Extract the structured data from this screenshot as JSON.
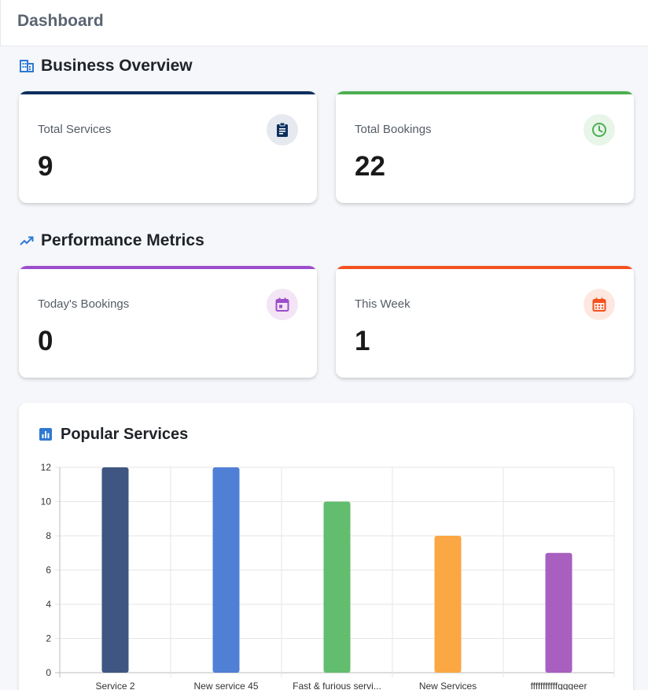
{
  "header": {
    "title": "Dashboard"
  },
  "sections": {
    "business": {
      "title": "Business Overview",
      "icon": "building-icon"
    },
    "performance": {
      "title": "Performance Metrics",
      "icon": "trending-up-icon"
    }
  },
  "cards": [
    {
      "label": "Total Services",
      "value": "9",
      "color": "#0d2f5e",
      "icon": "clipboard-icon"
    },
    {
      "label": "Total Bookings",
      "value": "22",
      "color": "#4caf50",
      "icon": "clock-icon"
    },
    {
      "label": "Today's Bookings",
      "value": "0",
      "color": "#9c4dcc",
      "icon": "calendar-icon"
    },
    {
      "label": "This Week",
      "value": "1",
      "color": "#f4511e",
      "icon": "calendar-week-icon"
    }
  ],
  "popular": {
    "title": "Popular Services",
    "icon": "bar-chart-icon"
  },
  "chart_data": {
    "type": "bar",
    "title": "Popular Services",
    "categories": [
      "Service 2",
      "New service 45",
      "Fast & furious servi...",
      "New Services",
      "fffffffffffgggeer"
    ],
    "values": [
      12,
      12,
      10,
      8,
      7
    ],
    "colors": [
      "#3e5681",
      "#5080d6",
      "#62bd6e",
      "#fba744",
      "#a85fc0"
    ],
    "ylim": [
      0,
      12
    ],
    "yticks": [
      0,
      2,
      4,
      6,
      8,
      10,
      12
    ],
    "grid": true
  }
}
